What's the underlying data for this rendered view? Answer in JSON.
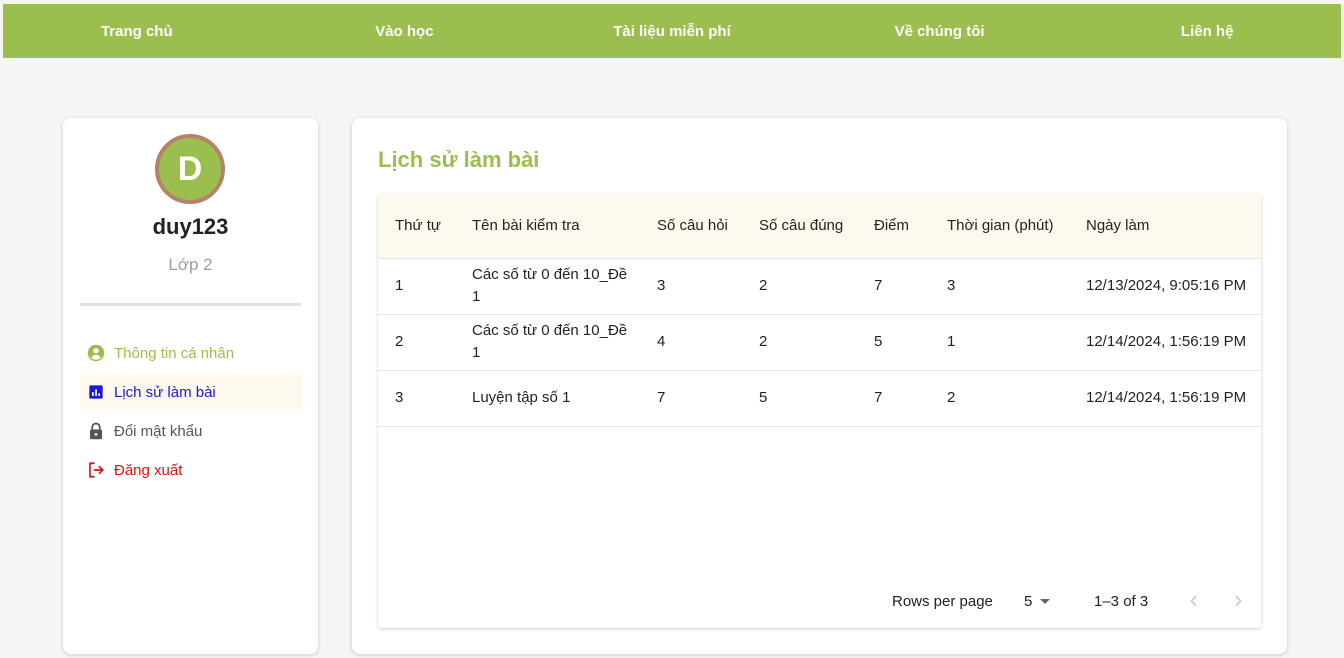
{
  "nav": {
    "items": [
      "Trang chủ",
      "Vào học",
      "Tài liệu miễn phí",
      "Về chúng tôi",
      "Liên hệ"
    ]
  },
  "profile": {
    "avatar_letter": "D",
    "username": "duy123",
    "class_name": "Lớp 2"
  },
  "menu": {
    "profile_label": "Thông tin cá nhân",
    "history_label": "Lịch sử làm bài",
    "password_label": "Đổi mật khẩu",
    "logout_label": "Đăng xuất"
  },
  "history": {
    "title": "Lịch sử làm bài",
    "columns": [
      "Thứ tự",
      "Tên bài kiểm tra",
      "Số câu hỏi",
      "Số câu đúng",
      "Điểm",
      "Thời gian (phút)",
      "Ngày làm"
    ],
    "rows": [
      [
        "1",
        "Các số từ 0 đến 10_Đề 1",
        "3",
        "2",
        "7",
        "3",
        "12/13/2024, 9:05:16 PM"
      ],
      [
        "2",
        "Các số từ 0 đến 10_Đề 1",
        "4",
        "2",
        "5",
        "1",
        "12/14/2024, 1:56:19 PM"
      ],
      [
        "3",
        "Luyện tập số 1",
        "7",
        "5",
        "7",
        "2",
        "12/14/2024, 1:56:19 PM"
      ]
    ]
  },
  "pagination": {
    "rows_per_page_label": "Rows per page",
    "rows_per_page_value": "5",
    "range_text": "1–3 of 3"
  },
  "colors": {
    "brand_green": "#9bbf4e",
    "active_blue": "#1a1ad6",
    "logout_red": "#e01010",
    "avatar_border": "#b5826a"
  }
}
